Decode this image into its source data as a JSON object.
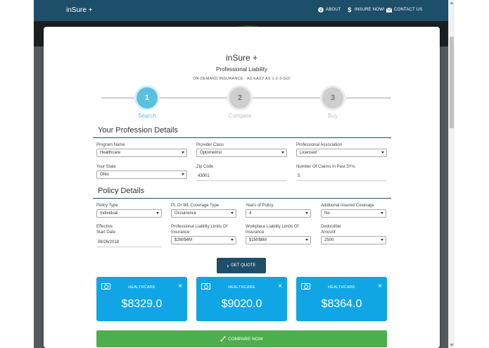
{
  "navbar": {
    "brand": "inSure +",
    "items": [
      {
        "icon": "info-circle-icon",
        "label": "ABOUT"
      },
      {
        "icon": "dollar-icon",
        "label": "INSURE NOW!"
      },
      {
        "icon": "envelope-icon",
        "label": "CONTACT US"
      }
    ]
  },
  "header": {
    "title": "inSure +",
    "subtitle": "Professional Liability",
    "tagline": "ON-DEMAND INSURANCE - AS EASY AS 1-2-3-GO!"
  },
  "stepper": {
    "steps": [
      {
        "number": "1",
        "label": "Search",
        "state": "active"
      },
      {
        "number": "2",
        "label": "Compare",
        "state": "inactive"
      },
      {
        "number": "3",
        "label": "Buy",
        "state": "inactive"
      }
    ]
  },
  "profession": {
    "title": "Your Profession Details",
    "program_name": {
      "label": "Program Name",
      "value": "Healthcare"
    },
    "provider_class": {
      "label": "Provider Class",
      "value": "Optometrist"
    },
    "association": {
      "label": "Professional Association",
      "value": "Licensed"
    },
    "state": {
      "label": "Your State",
      "value": "Ohio"
    },
    "zip": {
      "label": "Zip Code",
      "value": "43001"
    },
    "claims": {
      "label": "Number Of Claims In Past 5Yrs",
      "value": "5"
    }
  },
  "policy": {
    "title": "Policy Details",
    "policy_type": {
      "label": "Policy Type",
      "value": "Individual"
    },
    "coverage_type": {
      "label": "PL Or WL Coverage Type",
      "value": "Occurrence"
    },
    "years": {
      "label": "Years of Policy",
      "value": "4"
    },
    "additional": {
      "label": "Additional Insured Coverage",
      "value": "No"
    },
    "effective": {
      "label_line1": "Effective",
      "label_line2": "Start Date",
      "value": "06/26/2018"
    },
    "pl_limits": {
      "label_line1": "Professional Liability Limits Of",
      "label_line2": "Insurance",
      "value": "$2M/$4M"
    },
    "wl_limits": {
      "label_line1": "Workplace Liability Limits Of",
      "label_line2": "Insurance",
      "value": "$1M/$6M"
    },
    "deductible": {
      "label_line1": "Deductible",
      "label_line2": "Amount",
      "value": "2500"
    }
  },
  "actions": {
    "get_quote": "GET QUOTE",
    "compare_now": "COMPARE NOW"
  },
  "quotes": [
    {
      "label": "HEALTHCARE",
      "price": "$8329.0"
    },
    {
      "label": "HEALTHCARE",
      "price": "$9020.0"
    },
    {
      "label": "HEALTHCARE",
      "price": "$8364.0"
    }
  ],
  "colors": {
    "navbar": "#1d4e6a",
    "accent": "#5bc0de",
    "quote_card": "#10a6e6",
    "compare": "#4cae4c"
  }
}
